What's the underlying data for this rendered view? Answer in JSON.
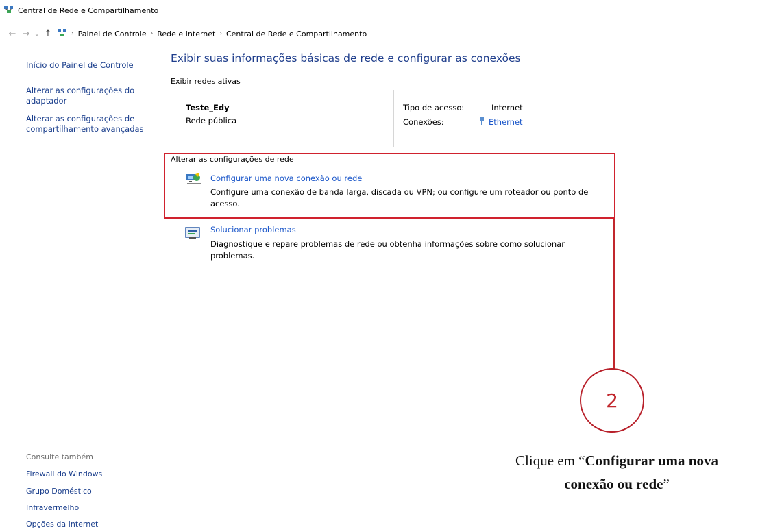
{
  "window": {
    "title": "Central de Rede e Compartilhamento"
  },
  "address": {
    "back": "←",
    "forward": "→",
    "dropdown": "⌄",
    "up": "↑",
    "crumbs": [
      "Painel de Controle",
      "Rede e Internet",
      "Central de Rede e Compartilhamento"
    ]
  },
  "sidebar": {
    "home": "Início do Painel de Controle",
    "adapter_line1": "Alterar as configurações do",
    "adapter_line2": "adaptador",
    "advanced_line1": "Alterar as configurações de",
    "advanced_line2": "compartilhamento avançadas"
  },
  "see_also": {
    "title": "Consulte também",
    "items": [
      "Firewall do Windows",
      "Grupo Doméstico",
      "Infravermelho",
      "Opções da Internet"
    ]
  },
  "main": {
    "heading": "Exibir suas informações básicas de rede e configurar as conexões",
    "active_title": "Exibir redes ativas",
    "network": {
      "name": "Teste_Edy",
      "type": "Rede pública",
      "access_label": "Tipo de acesso:",
      "access_value": "Internet",
      "connections_label": "Conexões:",
      "connections_value": "Ethernet"
    },
    "change_title": "Alterar as configurações de rede",
    "tasks": [
      {
        "link": "Configurar uma nova conexão ou rede",
        "desc_line1": "Configure uma conexão de banda larga, discada ou VPN; ou configure um roteador ou ponto de",
        "desc_line2": "acesso."
      },
      {
        "link": "Solucionar problemas",
        "desc_line1": "Diagnostique e repare problemas de rede ou obtenha informações sobre como solucionar",
        "desc_line2": "problemas."
      }
    ]
  },
  "annotation": {
    "step": "2",
    "caption_pre": "Clique em “",
    "caption_bold1": "Configurar uma nova",
    "caption_bold2": "conexão ou rede",
    "caption_post": "”"
  },
  "colors": {
    "highlight": "#d0222e",
    "link": "#1a56c9",
    "heading": "#1f3e8c"
  }
}
